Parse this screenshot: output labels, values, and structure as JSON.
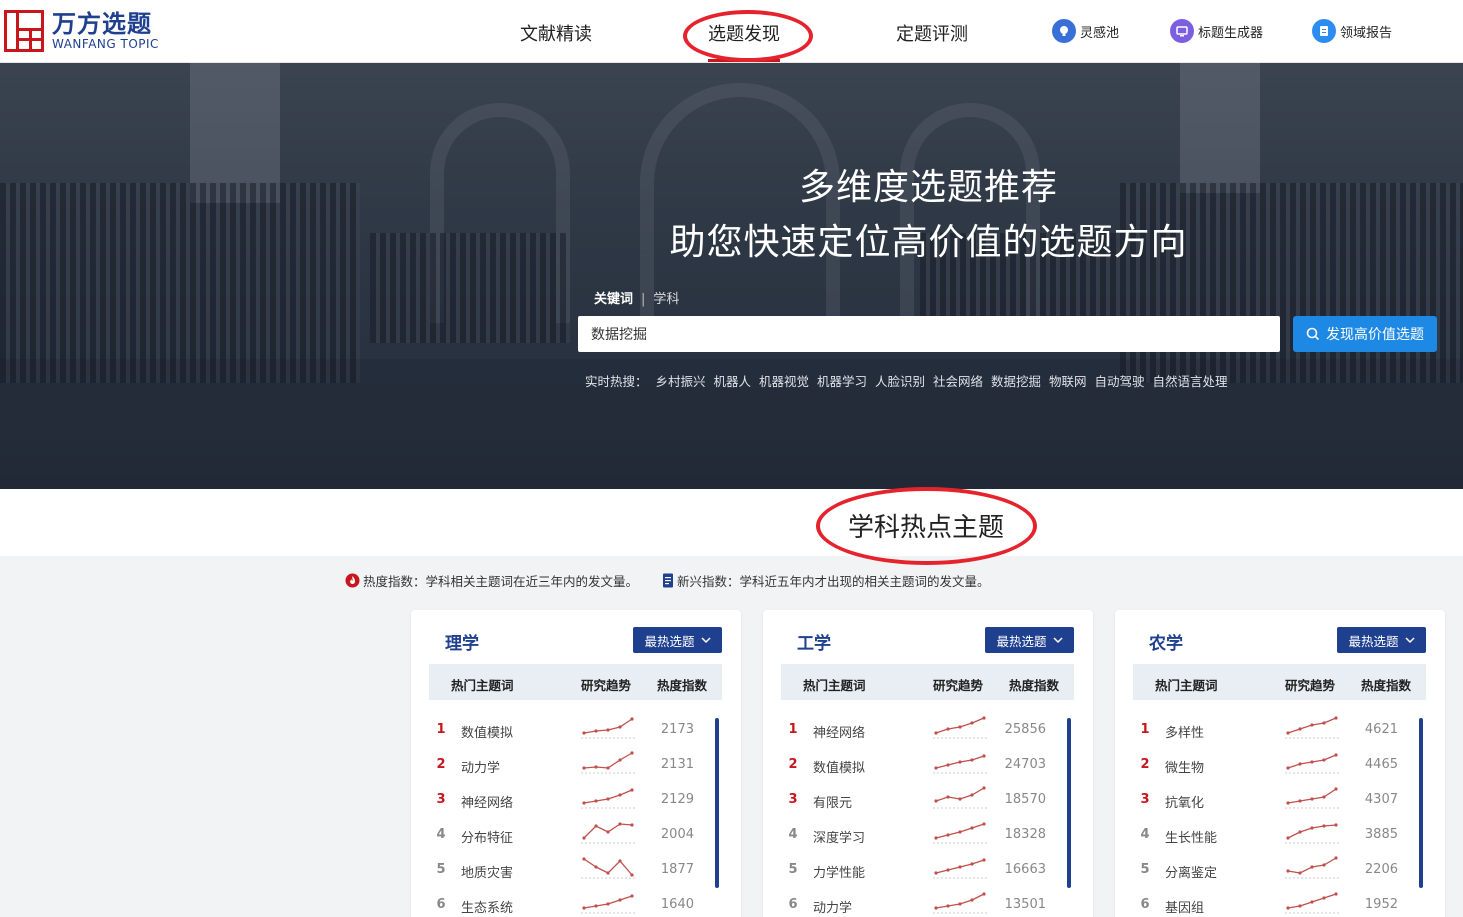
{
  "logo": {
    "cn": "万方选题",
    "en": "WANFANG TOPIC"
  },
  "nav": [
    {
      "label": "文献精读",
      "active": false
    },
    {
      "label": "选题发现",
      "active": true
    },
    {
      "label": "定题评测",
      "active": false
    }
  ],
  "tools": [
    {
      "label": "灵感池",
      "icon": "lightbulb-icon",
      "color": "#3a6fd8"
    },
    {
      "label": "标题生成器",
      "icon": "monitor-icon",
      "color": "#7b5fe0"
    },
    {
      "label": "领域报告",
      "icon": "report-icon",
      "color": "#2d8cf0"
    }
  ],
  "hero": {
    "line1": "多维度选题推荐",
    "line2": "助您快速定位高价值的选题方向",
    "tab_keyword": "关键词",
    "tab_separator": "|",
    "tab_subject": "学科",
    "search_value": "数据挖掘",
    "search_button": "发现高价值选题",
    "hot_label": "实时热搜：",
    "hot_terms": [
      "乡村振兴",
      "机器人",
      "机器视觉",
      "机器学习",
      "人脸识别",
      "社会网络",
      "数据挖掘",
      "物联网",
      "自动驾驶",
      "自然语言处理"
    ]
  },
  "section": {
    "title": "学科热点主题",
    "legend_hot": "热度指数：学科相关主题词在近三年内的发文量。",
    "legend_new": "新兴指数：学科近五年内才出现的相关主题词的发文量。"
  },
  "table_headers": {
    "term": "热门主题词",
    "trend": "研究趋势",
    "index": "热度指数"
  },
  "cards": [
    {
      "title": "理学",
      "dropdown": "最热选题",
      "rows": [
        {
          "rank": "1",
          "term": "数值模拟",
          "value": "2173",
          "trend": [
            0.2,
            0.3,
            0.35,
            0.5,
            0.9
          ]
        },
        {
          "rank": "2",
          "term": "动力学",
          "value": "2131",
          "trend": [
            0.2,
            0.25,
            0.2,
            0.6,
            0.95
          ]
        },
        {
          "rank": "3",
          "term": "神经网络",
          "value": "2129",
          "trend": [
            0.2,
            0.3,
            0.4,
            0.6,
            0.85
          ]
        },
        {
          "rank": "4",
          "term": "分布特征",
          "value": "2004",
          "trend": [
            0.2,
            0.8,
            0.5,
            0.9,
            0.85
          ]
        },
        {
          "rank": "5",
          "term": "地质灾害",
          "value": "1877",
          "trend": [
            0.9,
            0.5,
            0.2,
            0.8,
            0.1
          ]
        },
        {
          "rank": "6",
          "term": "生态系统",
          "value": "1640",
          "trend": [
            0.2,
            0.3,
            0.4,
            0.6,
            0.8
          ]
        }
      ]
    },
    {
      "title": "工学",
      "dropdown": "最热选题",
      "rows": [
        {
          "rank": "1",
          "term": "神经网络",
          "value": "25856",
          "trend": [
            0.2,
            0.4,
            0.5,
            0.7,
            0.95
          ]
        },
        {
          "rank": "2",
          "term": "数值模拟",
          "value": "24703",
          "trend": [
            0.2,
            0.35,
            0.5,
            0.6,
            0.8
          ]
        },
        {
          "rank": "3",
          "term": "有限元",
          "value": "18570",
          "trend": [
            0.3,
            0.5,
            0.4,
            0.6,
            0.95
          ]
        },
        {
          "rank": "4",
          "term": "深度学习",
          "value": "18328",
          "trend": [
            0.2,
            0.35,
            0.5,
            0.7,
            0.9
          ]
        },
        {
          "rank": "5",
          "term": "力学性能",
          "value": "16663",
          "trend": [
            0.2,
            0.35,
            0.5,
            0.65,
            0.85
          ]
        },
        {
          "rank": "6",
          "term": "动力学",
          "value": "13501",
          "trend": [
            0.2,
            0.3,
            0.4,
            0.6,
            0.9
          ]
        }
      ]
    },
    {
      "title": "农学",
      "dropdown": "最热选题",
      "rows": [
        {
          "rank": "1",
          "term": "多样性",
          "value": "4621",
          "trend": [
            0.2,
            0.4,
            0.6,
            0.7,
            0.95
          ]
        },
        {
          "rank": "2",
          "term": "微生物",
          "value": "4465",
          "trend": [
            0.2,
            0.4,
            0.5,
            0.6,
            0.85
          ]
        },
        {
          "rank": "3",
          "term": "抗氧化",
          "value": "4307",
          "trend": [
            0.2,
            0.3,
            0.4,
            0.5,
            0.9
          ]
        },
        {
          "rank": "4",
          "term": "生长性能",
          "value": "3885",
          "trend": [
            0.2,
            0.5,
            0.7,
            0.8,
            0.85
          ]
        },
        {
          "rank": "5",
          "term": "分离鉴定",
          "value": "2206",
          "trend": [
            0.3,
            0.2,
            0.5,
            0.6,
            0.95
          ]
        },
        {
          "rank": "6",
          "term": "基因组",
          "value": "1952",
          "trend": [
            0.2,
            0.3,
            0.5,
            0.7,
            0.9
          ]
        }
      ]
    }
  ],
  "colors": {
    "brand": "#1f3f8f",
    "accent": "#c8161d",
    "button": "#1e88e5",
    "trend_line": "#c0504d"
  }
}
